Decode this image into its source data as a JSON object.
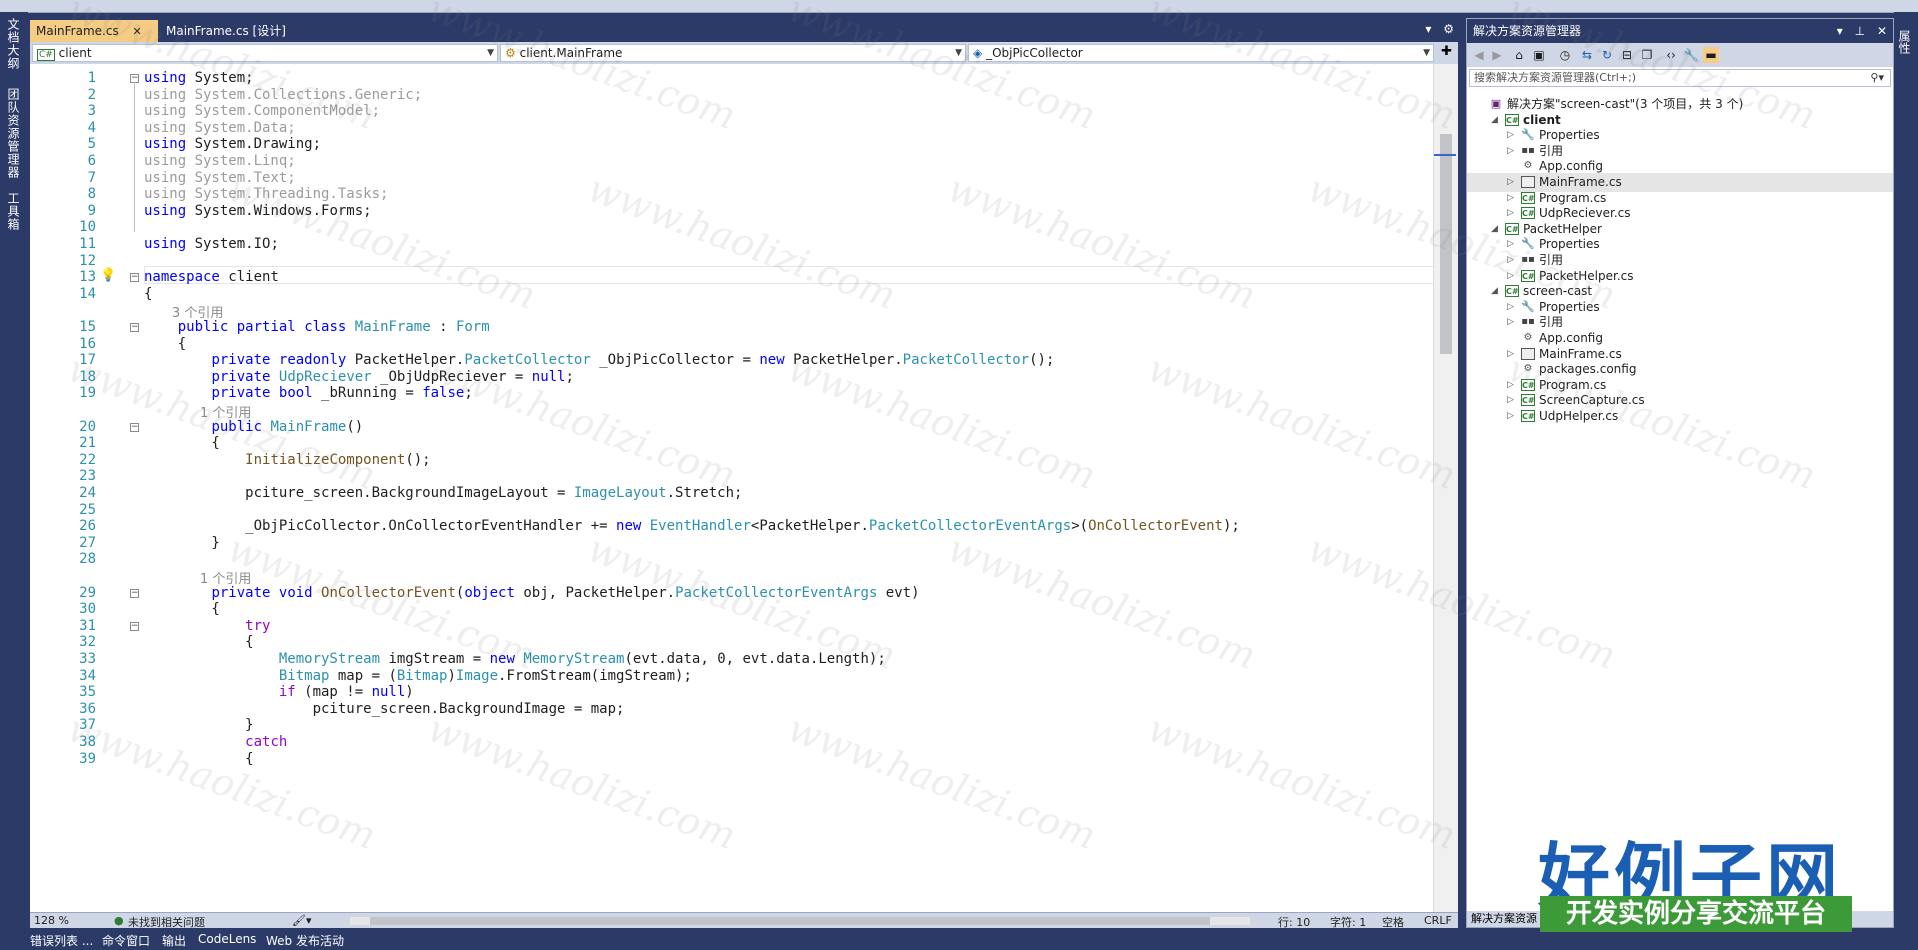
{
  "left_dock": {
    "tabs": [
      "文档大纲",
      "团队资源管理器",
      "工具箱"
    ]
  },
  "right_dock": {
    "tab": "属性"
  },
  "editor": {
    "tabs": [
      {
        "label": "MainFrame.cs",
        "active": true
      },
      {
        "label": "MainFrame.cs [设计]",
        "active": false
      }
    ],
    "nav": {
      "project": "client",
      "class": "client.MainFrame",
      "member": "_ObjPicCollector"
    },
    "lines": [
      {
        "n": "1",
        "html": "<span class=\"kw\">using</span> System;"
      },
      {
        "n": "2",
        "html": "<span class=\"dim\">using System.Collections.Generic;</span>"
      },
      {
        "n": "3",
        "html": "<span class=\"dim\">using System.ComponentModel;</span>"
      },
      {
        "n": "4",
        "html": "<span class=\"dim\">using System.Data;</span>"
      },
      {
        "n": "5",
        "html": "<span class=\"kw\">using</span> System.Drawing;"
      },
      {
        "n": "6",
        "html": "<span class=\"dim\">using System.Linq;</span>"
      },
      {
        "n": "7",
        "html": "<span class=\"dim\">using System.Text;</span>"
      },
      {
        "n": "8",
        "html": "<span class=\"dim\">using System.Threading.Tasks;</span>"
      },
      {
        "n": "9",
        "html": "<span class=\"kw\">using</span> System.Windows.Forms;"
      },
      {
        "n": "10",
        "html": ""
      },
      {
        "n": "11",
        "html": "<span class=\"kw\">using</span> System.IO;"
      },
      {
        "n": "12",
        "html": ""
      },
      {
        "n": "13",
        "html": "<span class=\"kw\">namespace</span> client"
      },
      {
        "n": "14",
        "html": "{"
      },
      {
        "lens": "3 个引用",
        "indent": 28
      },
      {
        "n": "15",
        "html": "    <span class=\"kw\">public</span> <span class=\"kw\">partial</span> <span class=\"kw\">class</span> <span class=\"ty\">MainFrame</span> : <span class=\"ty\">Form</span>"
      },
      {
        "n": "16",
        "html": "    {"
      },
      {
        "n": "17",
        "html": "        <span class=\"kw\">private</span> <span class=\"kw\">readonly</span> PacketHelper.<span class=\"ty\">PacketCollector</span> _ObjPicCollector = <span class=\"kw\">new</span> PacketHelper.<span class=\"ty\">PacketCollector</span>();"
      },
      {
        "n": "18",
        "html": "        <span class=\"kw\">private</span> <span class=\"ty\">UdpReciever</span> _ObjUdpReciever = <span class=\"kw\">null</span>;"
      },
      {
        "n": "19",
        "html": "        <span class=\"kw\">private</span> <span class=\"kw\">bool</span> _bRunning = <span class=\"kw\">false</span>;"
      },
      {
        "lens": "1 个引用",
        "indent": 56
      },
      {
        "n": "20",
        "html": "        <span class=\"kw\">public</span> <span class=\"ty\">MainFrame</span>()"
      },
      {
        "n": "21",
        "html": "        {"
      },
      {
        "n": "22",
        "html": "            <span class=\"me\">InitializeComponent</span>();"
      },
      {
        "n": "23",
        "html": ""
      },
      {
        "n": "24",
        "html": "            pciture_screen.BackgroundImageLayout = <span class=\"ty\">ImageLayout</span>.Stretch;"
      },
      {
        "n": "25",
        "html": ""
      },
      {
        "n": "26",
        "html": "            _ObjPicCollector.OnCollectorEventHandler += <span class=\"kw\">new</span> <span class=\"ty\">EventHandler</span>&lt;PacketHelper.<span class=\"ty\">PacketCollectorEventArgs</span>&gt;(<span class=\"me\">OnCollectorEvent</span>);"
      },
      {
        "n": "27",
        "html": "        }"
      },
      {
        "n": "28",
        "html": ""
      },
      {
        "lens": "1 个引用",
        "indent": 56
      },
      {
        "n": "29",
        "html": "        <span class=\"kw\">private</span> <span class=\"kw\">void</span> <span class=\"me\">OnCollectorEvent</span>(<span class=\"kw\">object</span> obj, PacketHelper.<span class=\"ty\">PacketCollectorEventArgs</span> evt)"
      },
      {
        "n": "30",
        "html": "        {"
      },
      {
        "n": "31",
        "html": "            <span class=\"ctl\">try</span>"
      },
      {
        "n": "32",
        "html": "            {"
      },
      {
        "n": "33",
        "html": "                <span class=\"ty\">MemoryStream</span> imgStream = <span class=\"kw\">new</span> <span class=\"ty\">MemoryStream</span>(evt.data, 0, evt.data.Length);"
      },
      {
        "n": "34",
        "html": "                <span class=\"ty\">Bitmap</span> map = (<span class=\"ty\">Bitmap</span>)<span class=\"ty\">Image</span>.FromStream(imgStream);"
      },
      {
        "n": "35",
        "html": "                <span class=\"ctl\">if</span> (map != <span class=\"kw\">null</span>)"
      },
      {
        "n": "36",
        "html": "                    pciture_screen.BackgroundImage = map;"
      },
      {
        "n": "37",
        "html": "            }"
      },
      {
        "n": "38",
        "html": "            <span class=\"ctl\">catch</span>"
      },
      {
        "n": "39",
        "html": "            {"
      }
    ]
  },
  "status": {
    "zoom": "128 %",
    "issues": "未找到相关问题",
    "line": "行: 10",
    "col": "字符: 1",
    "space": "空格",
    "eol": "CRLF"
  },
  "solution_explorer": {
    "title": "解决方案资源管理器",
    "search_placeholder": "搜索解决方案资源管理器(Ctrl+;)",
    "status": "解决方案资源",
    "tree": [
      {
        "label": "解决方案\"screen-cast\"(3 个项目，共 3 个)",
        "level": 0,
        "icon": "sol",
        "exp": ""
      },
      {
        "label": "client",
        "level": 1,
        "icon": "cs",
        "exp": "open",
        "bold": true
      },
      {
        "label": "Properties",
        "level": 2,
        "icon": "wr",
        "exp": "closed"
      },
      {
        "label": "引用",
        "level": 2,
        "icon": "ref",
        "exp": "closed"
      },
      {
        "label": "App.config",
        "level": 2,
        "icon": "cfg",
        "exp": ""
      },
      {
        "label": "MainFrame.cs",
        "level": 2,
        "icon": "frm",
        "exp": "closed",
        "selected": true
      },
      {
        "label": "Program.cs",
        "level": 2,
        "icon": "cs",
        "exp": "closed"
      },
      {
        "label": "UdpReciever.cs",
        "level": 2,
        "icon": "cs",
        "exp": "closed"
      },
      {
        "label": "PacketHelper",
        "level": 1,
        "icon": "cs",
        "exp": "open"
      },
      {
        "label": "Properties",
        "level": 2,
        "icon": "wr",
        "exp": "closed"
      },
      {
        "label": "引用",
        "level": 2,
        "icon": "ref",
        "exp": "closed"
      },
      {
        "label": "PacketHelper.cs",
        "level": 2,
        "icon": "cs",
        "exp": "closed"
      },
      {
        "label": "screen-cast",
        "level": 1,
        "icon": "cs",
        "exp": "open"
      },
      {
        "label": "Properties",
        "level": 2,
        "icon": "wr",
        "exp": "closed"
      },
      {
        "label": "引用",
        "level": 2,
        "icon": "ref",
        "exp": "closed"
      },
      {
        "label": "App.config",
        "level": 2,
        "icon": "cfg",
        "exp": ""
      },
      {
        "label": "MainFrame.cs",
        "level": 2,
        "icon": "frm",
        "exp": "closed"
      },
      {
        "label": "packages.config",
        "level": 2,
        "icon": "cfg",
        "exp": ""
      },
      {
        "label": "Program.cs",
        "level": 2,
        "icon": "cs",
        "exp": "closed"
      },
      {
        "label": "ScreenCapture.cs",
        "level": 2,
        "icon": "cs",
        "exp": "closed"
      },
      {
        "label": "UdpHelper.cs",
        "level": 2,
        "icon": "cs",
        "exp": "closed"
      }
    ]
  },
  "bottom_tabs": [
    "错误列表 ...",
    "命令窗口",
    "输出",
    "CodeLens",
    "Web 发布活动"
  ],
  "watermark": "www.haolizi.com",
  "logo": {
    "main": "好例子网",
    "sub": "开发实例分享交流平台"
  }
}
